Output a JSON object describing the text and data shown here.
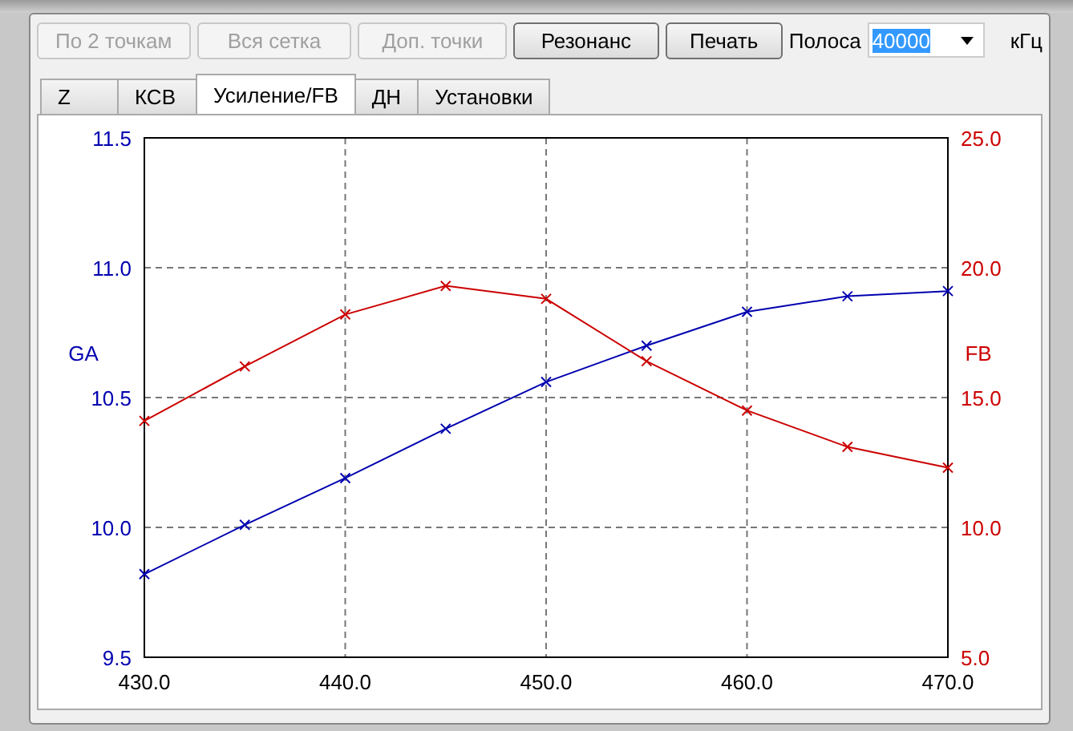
{
  "toolbar": {
    "buttons": [
      {
        "label": "По 2 точкам",
        "disabled": true
      },
      {
        "label": "Вся сетка",
        "disabled": true
      },
      {
        "label": "Доп. точки",
        "disabled": true
      },
      {
        "label": "Резонанс",
        "disabled": false
      },
      {
        "label": "Печать",
        "disabled": false
      }
    ],
    "band": {
      "label": "Полоса",
      "value": "40000",
      "unit": "кГц"
    }
  },
  "tabs": [
    {
      "label": "Z",
      "selected": false
    },
    {
      "label": "КСВ",
      "selected": false
    },
    {
      "label": "Усиление/FB",
      "selected": true
    },
    {
      "label": "ДН",
      "selected": false
    },
    {
      "label": "Установки",
      "selected": false
    }
  ],
  "chart": {
    "chart_data": {
      "type": "line",
      "grid": true,
      "x": [
        430,
        435,
        440,
        445,
        450,
        455,
        460,
        465,
        470
      ],
      "xlim": [
        430,
        470
      ],
      "xticks": [
        {
          "value": 430,
          "label": "430.0"
        },
        {
          "value": 440,
          "label": "440.0"
        },
        {
          "value": 450,
          "label": "450.0"
        },
        {
          "value": 460,
          "label": "460.0"
        },
        {
          "value": 470,
          "label": "470.0"
        }
      ],
      "ylim": [
        9.5,
        11.5
      ],
      "yticks": [
        {
          "value": 9.5,
          "label": "9.5"
        },
        {
          "value": 10,
          "label": "10.0"
        },
        {
          "value": 10.5,
          "label": "10.5"
        },
        {
          "value": 11,
          "label": "11.0"
        },
        {
          "value": 11.5,
          "label": "11.5"
        }
      ],
      "y2lim": [
        5,
        25
      ],
      "y2ticks": [
        {
          "value": 5,
          "label": "5.0"
        },
        {
          "value": 10,
          "label": "10.0"
        },
        {
          "value": 15,
          "label": "15.0"
        },
        {
          "value": 20,
          "label": "20.0"
        },
        {
          "value": 25,
          "label": "25.0"
        }
      ],
      "series": [
        {
          "name": "GA",
          "color": "#0000b0",
          "axis": "y",
          "marker": "x",
          "values": [
            9.82,
            10.01,
            10.19,
            10.38,
            10.56,
            10.7,
            10.83,
            10.89,
            10.91
          ]
        },
        {
          "name": "FB",
          "color": "#cc0000",
          "axis": "y2",
          "marker": "x",
          "values": [
            14.1,
            16.2,
            18.2,
            19.3,
            18.8,
            16.4,
            14.5,
            13.1,
            12.3
          ]
        }
      ]
    }
  }
}
